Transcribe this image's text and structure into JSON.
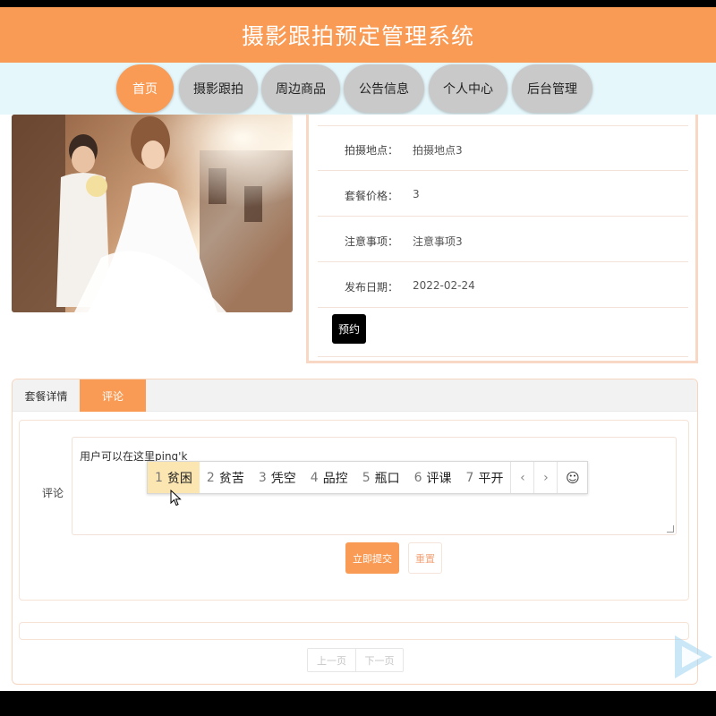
{
  "header": {
    "title": "摄影跟拍预定管理系统"
  },
  "nav": {
    "items": [
      {
        "label": "首页"
      },
      {
        "label": "摄影跟拍"
      },
      {
        "label": "周边商品"
      },
      {
        "label": "公告信息"
      },
      {
        "label": "个人中心"
      },
      {
        "label": "后台管理"
      }
    ],
    "active_color": "#f99b55"
  },
  "details": {
    "rows": [
      {
        "label": "拍摄地点：",
        "value": "拍摄地点3"
      },
      {
        "label": "套餐价格：",
        "value": "3"
      },
      {
        "label": "注意事项：",
        "value": "注意事项3"
      },
      {
        "label": "发布日期：",
        "value": "2022-02-24"
      }
    ],
    "book_label": "预约"
  },
  "tabs": [
    {
      "label": "套餐详情"
    },
    {
      "label": "评论"
    }
  ],
  "comment_form": {
    "label": "评论",
    "typed_text": "用户可以在这里ping'k",
    "submit_label": "立即提交",
    "reset_label": "重置"
  },
  "ime": {
    "candidates": [
      {
        "num": "1",
        "text": "贫困"
      },
      {
        "num": "2",
        "text": "贫苦"
      },
      {
        "num": "3",
        "text": "凭空"
      },
      {
        "num": "4",
        "text": "品控"
      },
      {
        "num": "5",
        "text": "瓶口"
      },
      {
        "num": "6",
        "text": "评课"
      },
      {
        "num": "7",
        "text": "平开"
      }
    ],
    "prev": "‹",
    "next": "›",
    "emoji": "☺"
  },
  "pager": {
    "prev": "上一页",
    "next": "下一页"
  }
}
